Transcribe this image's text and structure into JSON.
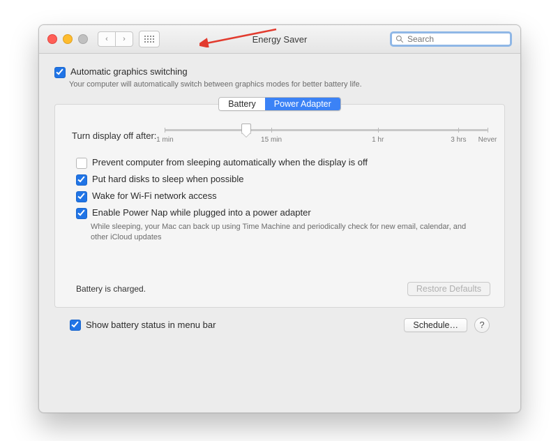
{
  "window_title": "Energy Saver",
  "search_placeholder": "Search",
  "automatic_switching": {
    "label": "Automatic graphics switching",
    "description": "Your computer will automatically switch between graphics modes for better battery life.",
    "checked": true
  },
  "tabs": {
    "battery": "Battery",
    "power_adapter": "Power Adapter",
    "active": "power_adapter"
  },
  "slider": {
    "label": "Turn display off after:",
    "ticks": [
      "1 min",
      "15 min",
      "1 hr",
      "3 hrs",
      "Never"
    ]
  },
  "options": [
    {
      "label": "Prevent computer from sleeping automatically when the display is off",
      "checked": false
    },
    {
      "label": "Put hard disks to sleep when possible",
      "checked": true
    },
    {
      "label": "Wake for Wi-Fi network access",
      "checked": true
    },
    {
      "label": "Enable Power Nap while plugged into a power adapter",
      "checked": true,
      "description": "While sleeping, your Mac can back up using Time Machine and periodically check for new email, calendar, and other iCloud updates"
    }
  ],
  "battery_status": "Battery is charged.",
  "restore_defaults": "Restore Defaults",
  "show_menu_bar": {
    "label": "Show battery status in menu bar",
    "checked": true
  },
  "schedule_button": "Schedule…",
  "help_label": "?"
}
